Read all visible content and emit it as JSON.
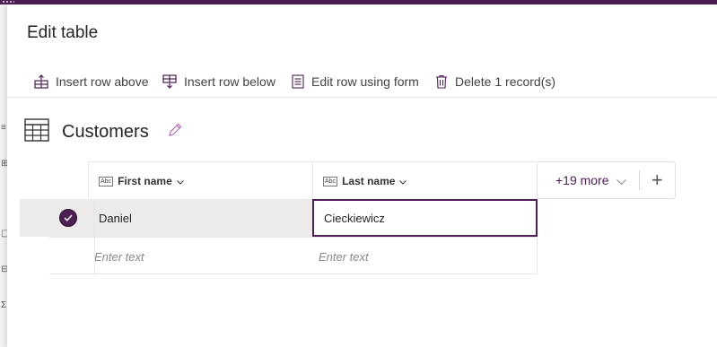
{
  "panel": {
    "title": "Edit table"
  },
  "toolbar": {
    "insert_row_above": "Insert row above",
    "insert_row_below": "Insert row below",
    "edit_row_form": "Edit row using form",
    "delete_records": "Delete 1 record(s)"
  },
  "table": {
    "name": "Customers",
    "columns": [
      {
        "type_badge": "Abc",
        "label": "First name"
      },
      {
        "type_badge": "Abc",
        "label": "Last name"
      }
    ],
    "more_columns": "+19 more",
    "rows": [
      {
        "selected": true,
        "first_name": "Daniel",
        "last_name": "Cieckiewicz"
      }
    ],
    "placeholder": "Enter text"
  },
  "colors": {
    "accent": "#4b1f51",
    "selected_row": "#edebe9"
  }
}
